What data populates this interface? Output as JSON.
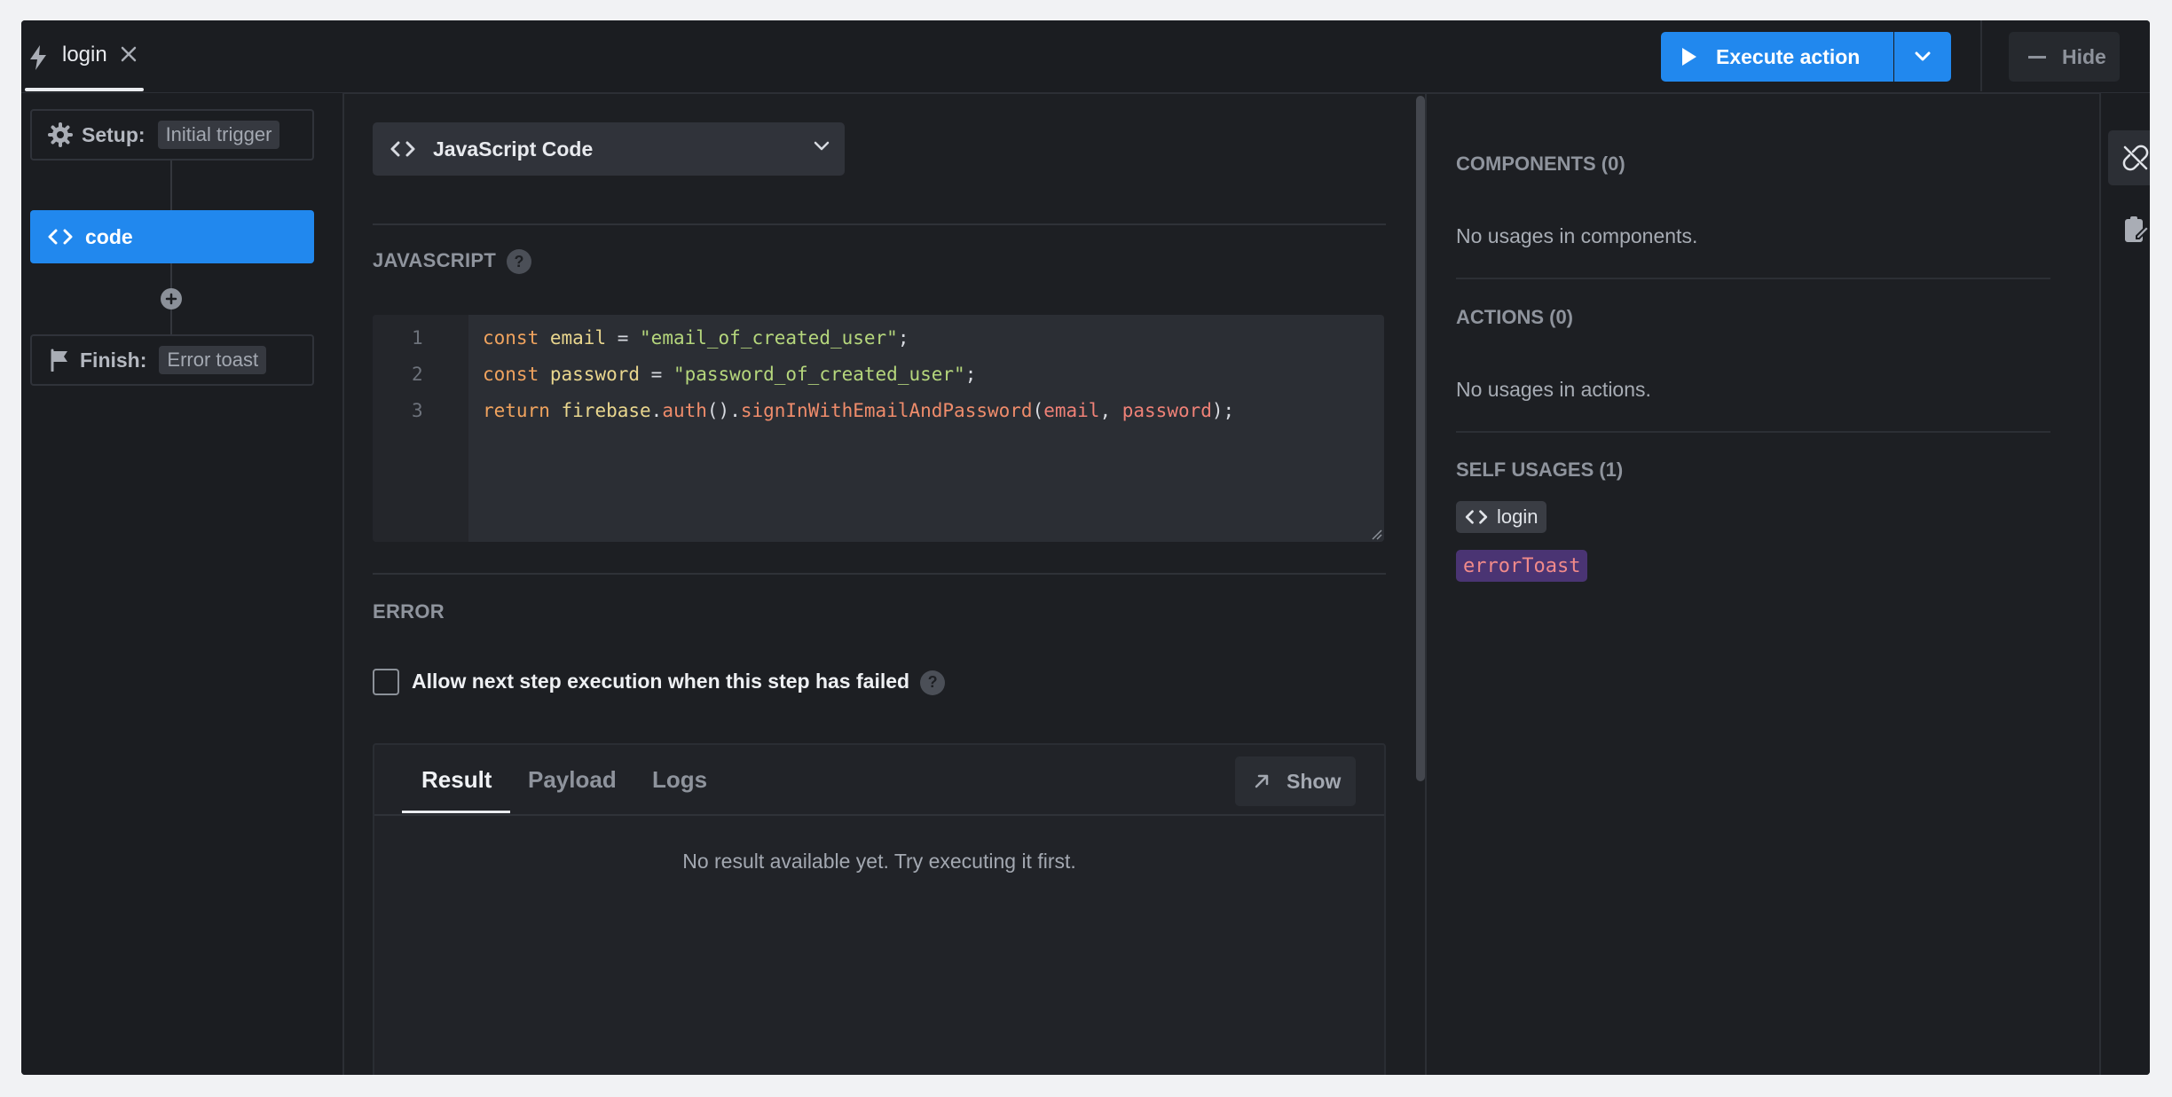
{
  "tab": {
    "title": "login"
  },
  "toolbar": {
    "execute_label": "Execute action",
    "hide_label": "Hide"
  },
  "steps": {
    "setup_label": "Setup:",
    "setup_value": "Initial trigger",
    "active_label": "code",
    "finish_label": "Finish:",
    "finish_value": "Error toast"
  },
  "editor": {
    "action_type": "JavaScript Code",
    "section_title": "JAVASCRIPT",
    "line_numbers": [
      "1",
      "2",
      "3"
    ],
    "code": {
      "line1": {
        "kw": "const",
        "var": "email",
        "eq": " = ",
        "str": "\"email_of_created_user\"",
        "end": ";"
      },
      "line2": {
        "kw": "const",
        "var": "password",
        "eq": " = ",
        "str": "\"password_of_created_user\"",
        "end": ";"
      },
      "line3": {
        "kw": "return",
        "obj": "firebase",
        "dot1": ".",
        "fn1": "auth",
        "paren1": "().",
        "fn2": "signInWithEmailAndPassword",
        "open": "(",
        "p1": "email",
        "comma": ", ",
        "p2": "password",
        "close": ");"
      }
    }
  },
  "error": {
    "section_title": "ERROR",
    "checkbox_label": "Allow next step execution when this step has failed",
    "checked": false
  },
  "help_glyph": "?",
  "result": {
    "tabs": [
      "Result",
      "Payload",
      "Logs"
    ],
    "active_tab": "Result",
    "show_label": "Show",
    "empty_text": "No result available yet. Try executing it first."
  },
  "usages": {
    "components_title": "COMPONENTS (0)",
    "components_text": "No usages in components.",
    "actions_title": "ACTIONS (0)",
    "actions_text": "No usages in actions.",
    "self_title": "SELF USAGES (1)",
    "self_chip": "login",
    "variable_chip": "errorToast"
  },
  "colors": {
    "accent": "#2188ee",
    "background": "#1d1f23",
    "variable_chip": "#4a3473"
  },
  "icons": [
    "bolt-icon",
    "close-icon",
    "play-icon",
    "chevron-down-icon",
    "minus-icon",
    "gear-icon",
    "code-icon",
    "flag-icon",
    "plus-icon",
    "help-icon",
    "arrow-up-right-icon",
    "unlink-icon",
    "clipboard-edit-icon"
  ]
}
